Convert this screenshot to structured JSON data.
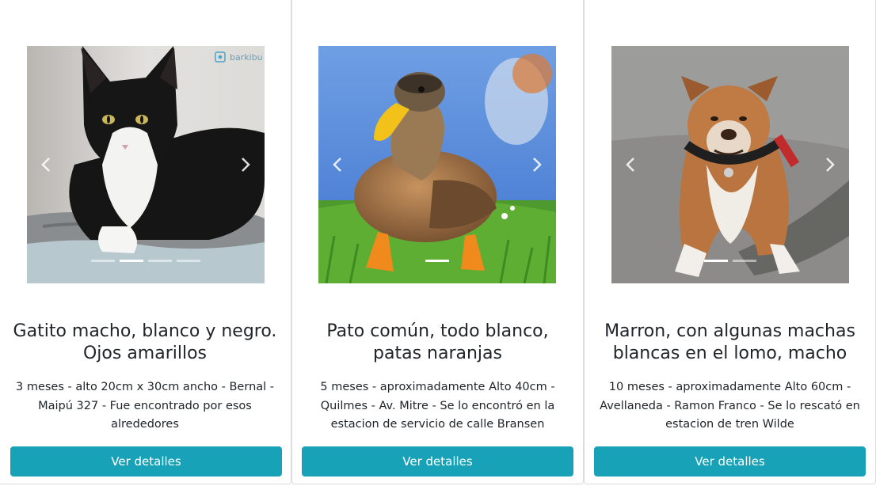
{
  "colors": {
    "button": "#17a2b8",
    "card_border": "#dcdcdc",
    "text": "#212529"
  },
  "cards": [
    {
      "title": "Gatito macho, blanco y negro. Ojos amarillos",
      "description": "3 meses - alto 20cm x 30cm ancho - Bernal - Maipú 327 - Fue encontrado por esos alrededores",
      "button_label": "Ver detalles",
      "image": "tuxedo-cat-photo",
      "watermark": "barkibu",
      "indicators": 4,
      "active_indicator": 2,
      "prev_icon": "chevron-left-icon",
      "next_icon": "chevron-right-icon"
    },
    {
      "title": "Pato común, todo blanco, patas naranjas",
      "description": "5 meses - aproximadamente Alto 40cm - Quilmes - Av. Mitre - Se lo encontró en la estacion de servicio de calle Bransen",
      "button_label": "Ver detalles",
      "image": "mallard-duck-photo",
      "indicators": 1,
      "active_indicator": 1,
      "prev_icon": "chevron-left-icon",
      "next_icon": "chevron-right-icon"
    },
    {
      "title": "Marron, con algunas machas blancas en el lomo, macho",
      "description": "10 meses - aproximadamente Alto 60cm - Avellaneda - Ramon Franco - Se lo rescató en estacion de tren Wilde",
      "button_label": "Ver detalles",
      "image": "staffordshire-terrier-photo",
      "indicators": 2,
      "active_indicator": 1,
      "prev_icon": "chevron-left-icon",
      "next_icon": "chevron-right-icon"
    }
  ]
}
